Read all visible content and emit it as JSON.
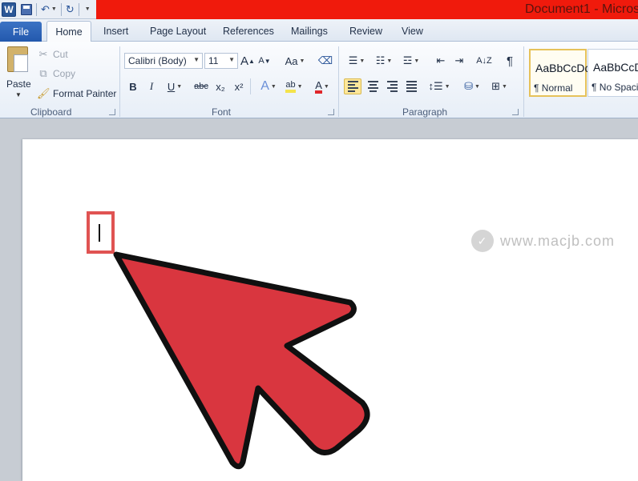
{
  "window": {
    "title": "Document1 - Micros",
    "qat_icons": [
      "word-logo-icon",
      "save-icon",
      "undo-icon",
      "redo-icon",
      "customize-icon"
    ],
    "word_logo_letter": "W"
  },
  "tabs": {
    "file": "File",
    "home": "Home",
    "insert": "Insert",
    "page_layout": "Page Layout",
    "references": "References",
    "mailings": "Mailings",
    "review": "Review",
    "view": "View"
  },
  "clipboard": {
    "group_label": "Clipboard",
    "paste": "Paste",
    "cut": "Cut",
    "copy": "Copy",
    "format_painter": "Format Painter"
  },
  "font": {
    "group_label": "Font",
    "font_name": "Calibri (Body)",
    "font_size": "11",
    "bold": "B",
    "italic": "I",
    "underline": "U",
    "strikethrough": "abc",
    "subscript": "x₂",
    "superscript": "x²",
    "change_case": "Aa",
    "text_effects": "A",
    "highlight": "ab",
    "font_color": "A",
    "grow": "A",
    "shrink": "A",
    "accent_colors": {
      "highlight": "#f4e34c",
      "font_color": "#e0262a"
    }
  },
  "paragraph": {
    "group_label": "Paragraph",
    "pilcrow": "¶",
    "sort": "A↓Z"
  },
  "styles": {
    "items": [
      {
        "sample": "AaBbCcDc",
        "name": "¶ Normal"
      },
      {
        "sample": "AaBbCcDc",
        "name": "¶ No Spaci..."
      }
    ]
  },
  "document": {
    "watermark": "www.macjb.com",
    "highlight_color": "#e05352",
    "arrow_color": "#d9363f"
  }
}
